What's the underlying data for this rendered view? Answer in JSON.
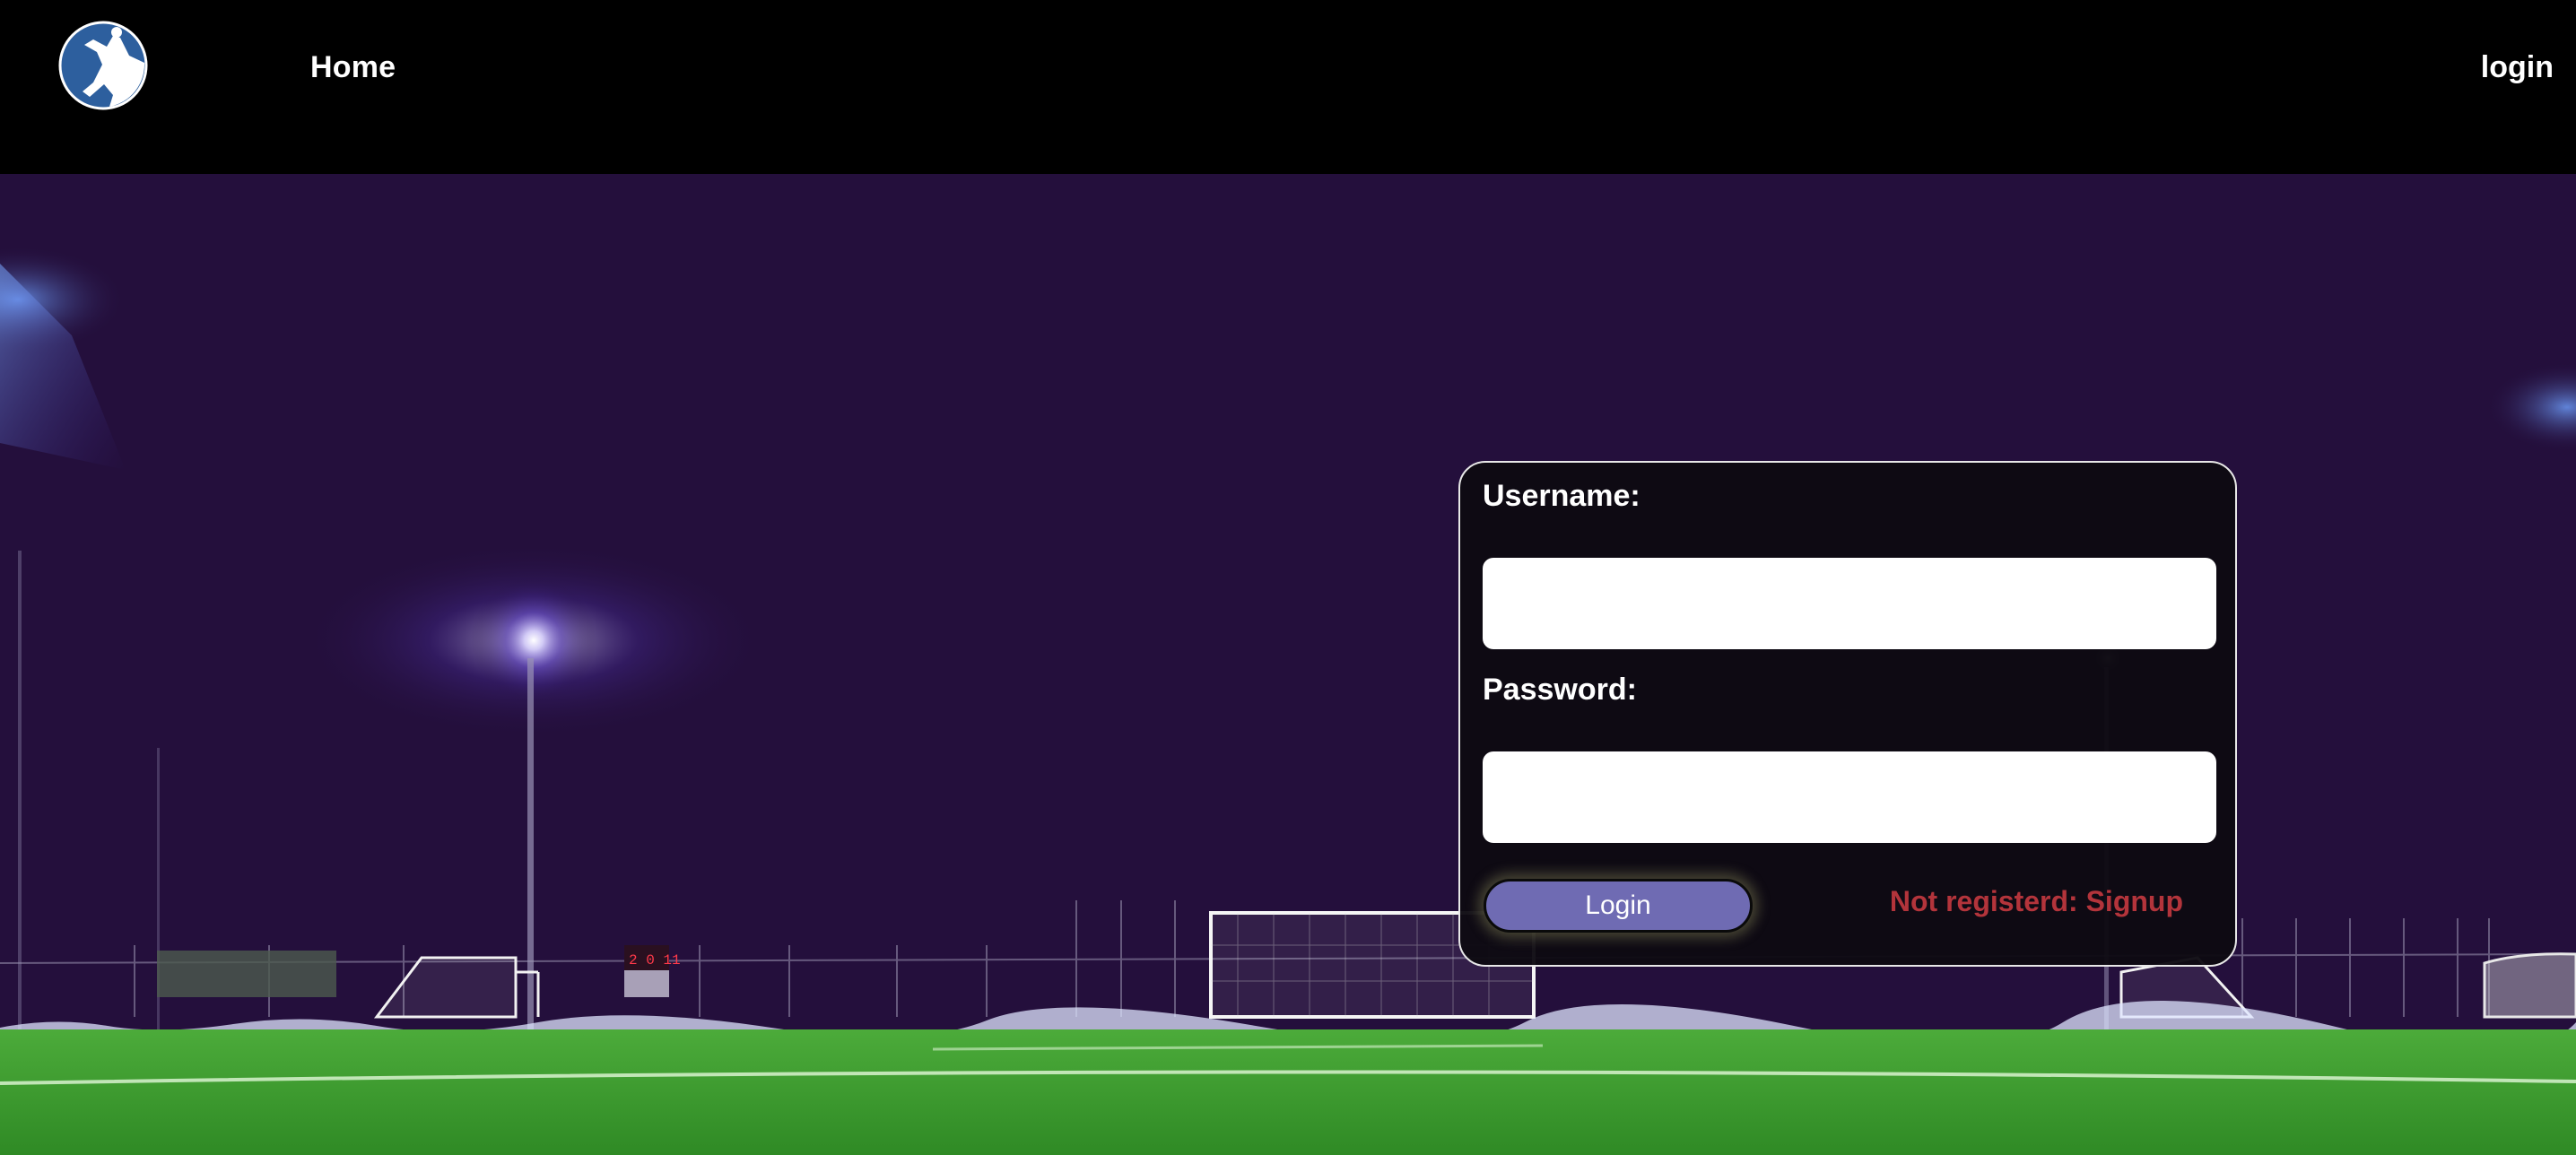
{
  "nav": {
    "logo_icon": "soccer-player-logo-icon",
    "home_label": "Home",
    "login_label": "login"
  },
  "login_form": {
    "username_label": "Username:",
    "username_value": "",
    "password_label": "Password:",
    "password_value": "",
    "submit_label": "Login",
    "signup_link_text": "Not registerd: Signup"
  },
  "colors": {
    "header_bg": "#000000",
    "sky": "#240f3c",
    "pitch": "#3a9a2c",
    "card_bg": "#0e0a12",
    "button_bg": "#6f6bb3",
    "signup_link": "#b3343b"
  }
}
